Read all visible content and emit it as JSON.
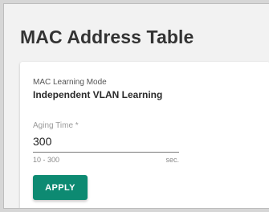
{
  "page": {
    "title": "MAC Address Table"
  },
  "form": {
    "learning_mode": {
      "label": "MAC Learning Mode",
      "value": "Independent VLAN Learning"
    },
    "aging_time": {
      "label": "Aging Time *",
      "value": "300",
      "range_hint": "10 - 300",
      "unit": "sec."
    },
    "apply_label": "APPLY"
  },
  "colors": {
    "accent": "#0d8a72",
    "page_background": "#f2f2f2",
    "card_background": "#ffffff"
  }
}
